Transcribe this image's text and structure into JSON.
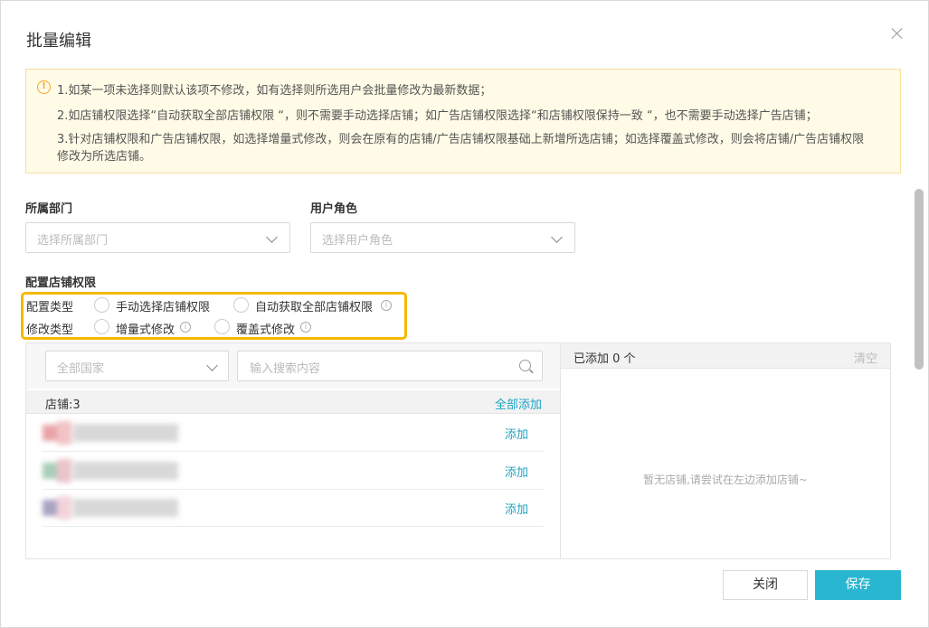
{
  "dialog": {
    "title": "批量编辑"
  },
  "notice": {
    "line1": "1.如某一项未选择则默认该项不修改，如有选择则所选用户会批量修改为最新数据；",
    "line2": "2.如店铺权限选择“自动获取全部店铺权限 “，则不需要手动选择店铺；如广告店铺权限选择“和店铺权限保持一致 “，也不需要手动选择广告店铺；",
    "line3a": "3.针对店铺权限和广告店铺权限，如选择增量式修改，则会在原有的店铺/广告店铺权限基础上新增所选店铺；如选择覆盖式修改，则会将店铺/广告店铺权限",
    "line3b": "修改为所选店铺。"
  },
  "form": {
    "department_label": "所属部门",
    "department_placeholder": "选择所属部门",
    "role_label": "用户角色",
    "role_placeholder": "选择用户角色",
    "store_perm_label": "配置店铺权限",
    "config_type_label": "配置类型",
    "config_options": [
      "手动选择店铺权限",
      "自动获取全部店铺权限"
    ],
    "modify_type_label": "修改类型",
    "modify_options": [
      "增量式修改",
      "覆盖式修改"
    ]
  },
  "store_list": {
    "country_placeholder": "全部国家",
    "search_placeholder": "输入搜索内容",
    "count_label": "店铺:3",
    "add_all_label": "全部添加",
    "add_label": "添加",
    "rows": [
      {
        "c1": "#e9a3a8",
        "c2": "#f2c3c6"
      },
      {
        "c1": "#a9cdb8",
        "c2": "#ecc3ca"
      },
      {
        "c1": "#a9a3c3",
        "c2": "#f3d3da"
      }
    ]
  },
  "selected": {
    "added_label": "已添加 0 个",
    "clear_label": "清空",
    "empty_message": "暂无店铺,请尝试在左边添加店铺~"
  },
  "footer": {
    "close_label": "关闭",
    "save_label": "保存"
  },
  "colors": {
    "accent": "#29b6d1",
    "link": "#1fa3c3",
    "highlight": "#f5b800",
    "notice_bg": "#fffbe6"
  }
}
